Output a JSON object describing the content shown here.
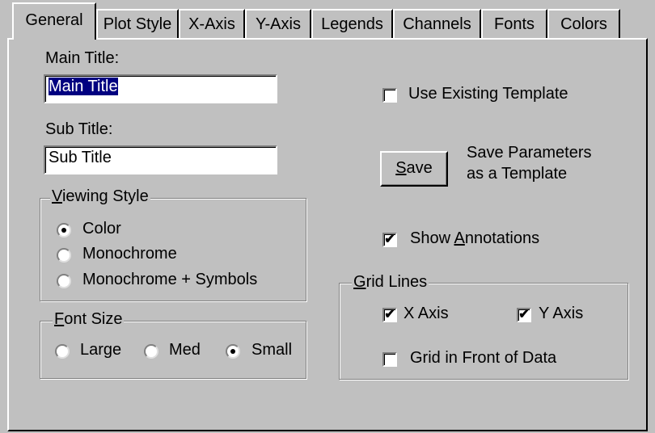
{
  "tabs": [
    {
      "label": "General",
      "active": true
    },
    {
      "label": "Plot Style"
    },
    {
      "label": "X-Axis"
    },
    {
      "label": "Y-Axis"
    },
    {
      "label": "Legends"
    },
    {
      "label": "Channels"
    },
    {
      "label": "Fonts"
    },
    {
      "label": "Colors"
    }
  ],
  "main_title": {
    "label": "Main Title:",
    "value": "Main Title"
  },
  "sub_title": {
    "label": "Sub Title:",
    "value": "Sub Title"
  },
  "viewing_style": {
    "label_first": "V",
    "label_rest": "iewing Style",
    "options": [
      {
        "label": "Color",
        "selected": true
      },
      {
        "label": "Monochrome",
        "selected": false
      },
      {
        "label": "Monochrome + Symbols",
        "selected": false
      }
    ]
  },
  "font_size": {
    "label_first": "F",
    "label_rest": "ont Size",
    "options": [
      {
        "label": "Large",
        "selected": false
      },
      {
        "label": "Med",
        "selected": false
      },
      {
        "label": "Small",
        "selected": true
      }
    ]
  },
  "use_existing_template": {
    "label": "Use Existing Template",
    "checked": false
  },
  "save": {
    "button_first": "S",
    "button_rest": "ave",
    "description_line1": "Save Parameters",
    "description_line2": "as a Template"
  },
  "show_annotations": {
    "label_pre": "Show ",
    "label_mn": "A",
    "label_post": "nnotations",
    "checked": true
  },
  "grid_lines": {
    "label_first": "G",
    "label_rest": "rid Lines",
    "x_axis": {
      "label": "X Axis",
      "checked": true
    },
    "y_axis": {
      "label": "Y Axis",
      "checked": true
    },
    "grid_in_front": {
      "label": "Grid in Front of Data",
      "checked": false
    }
  },
  "check_mark": "✔"
}
